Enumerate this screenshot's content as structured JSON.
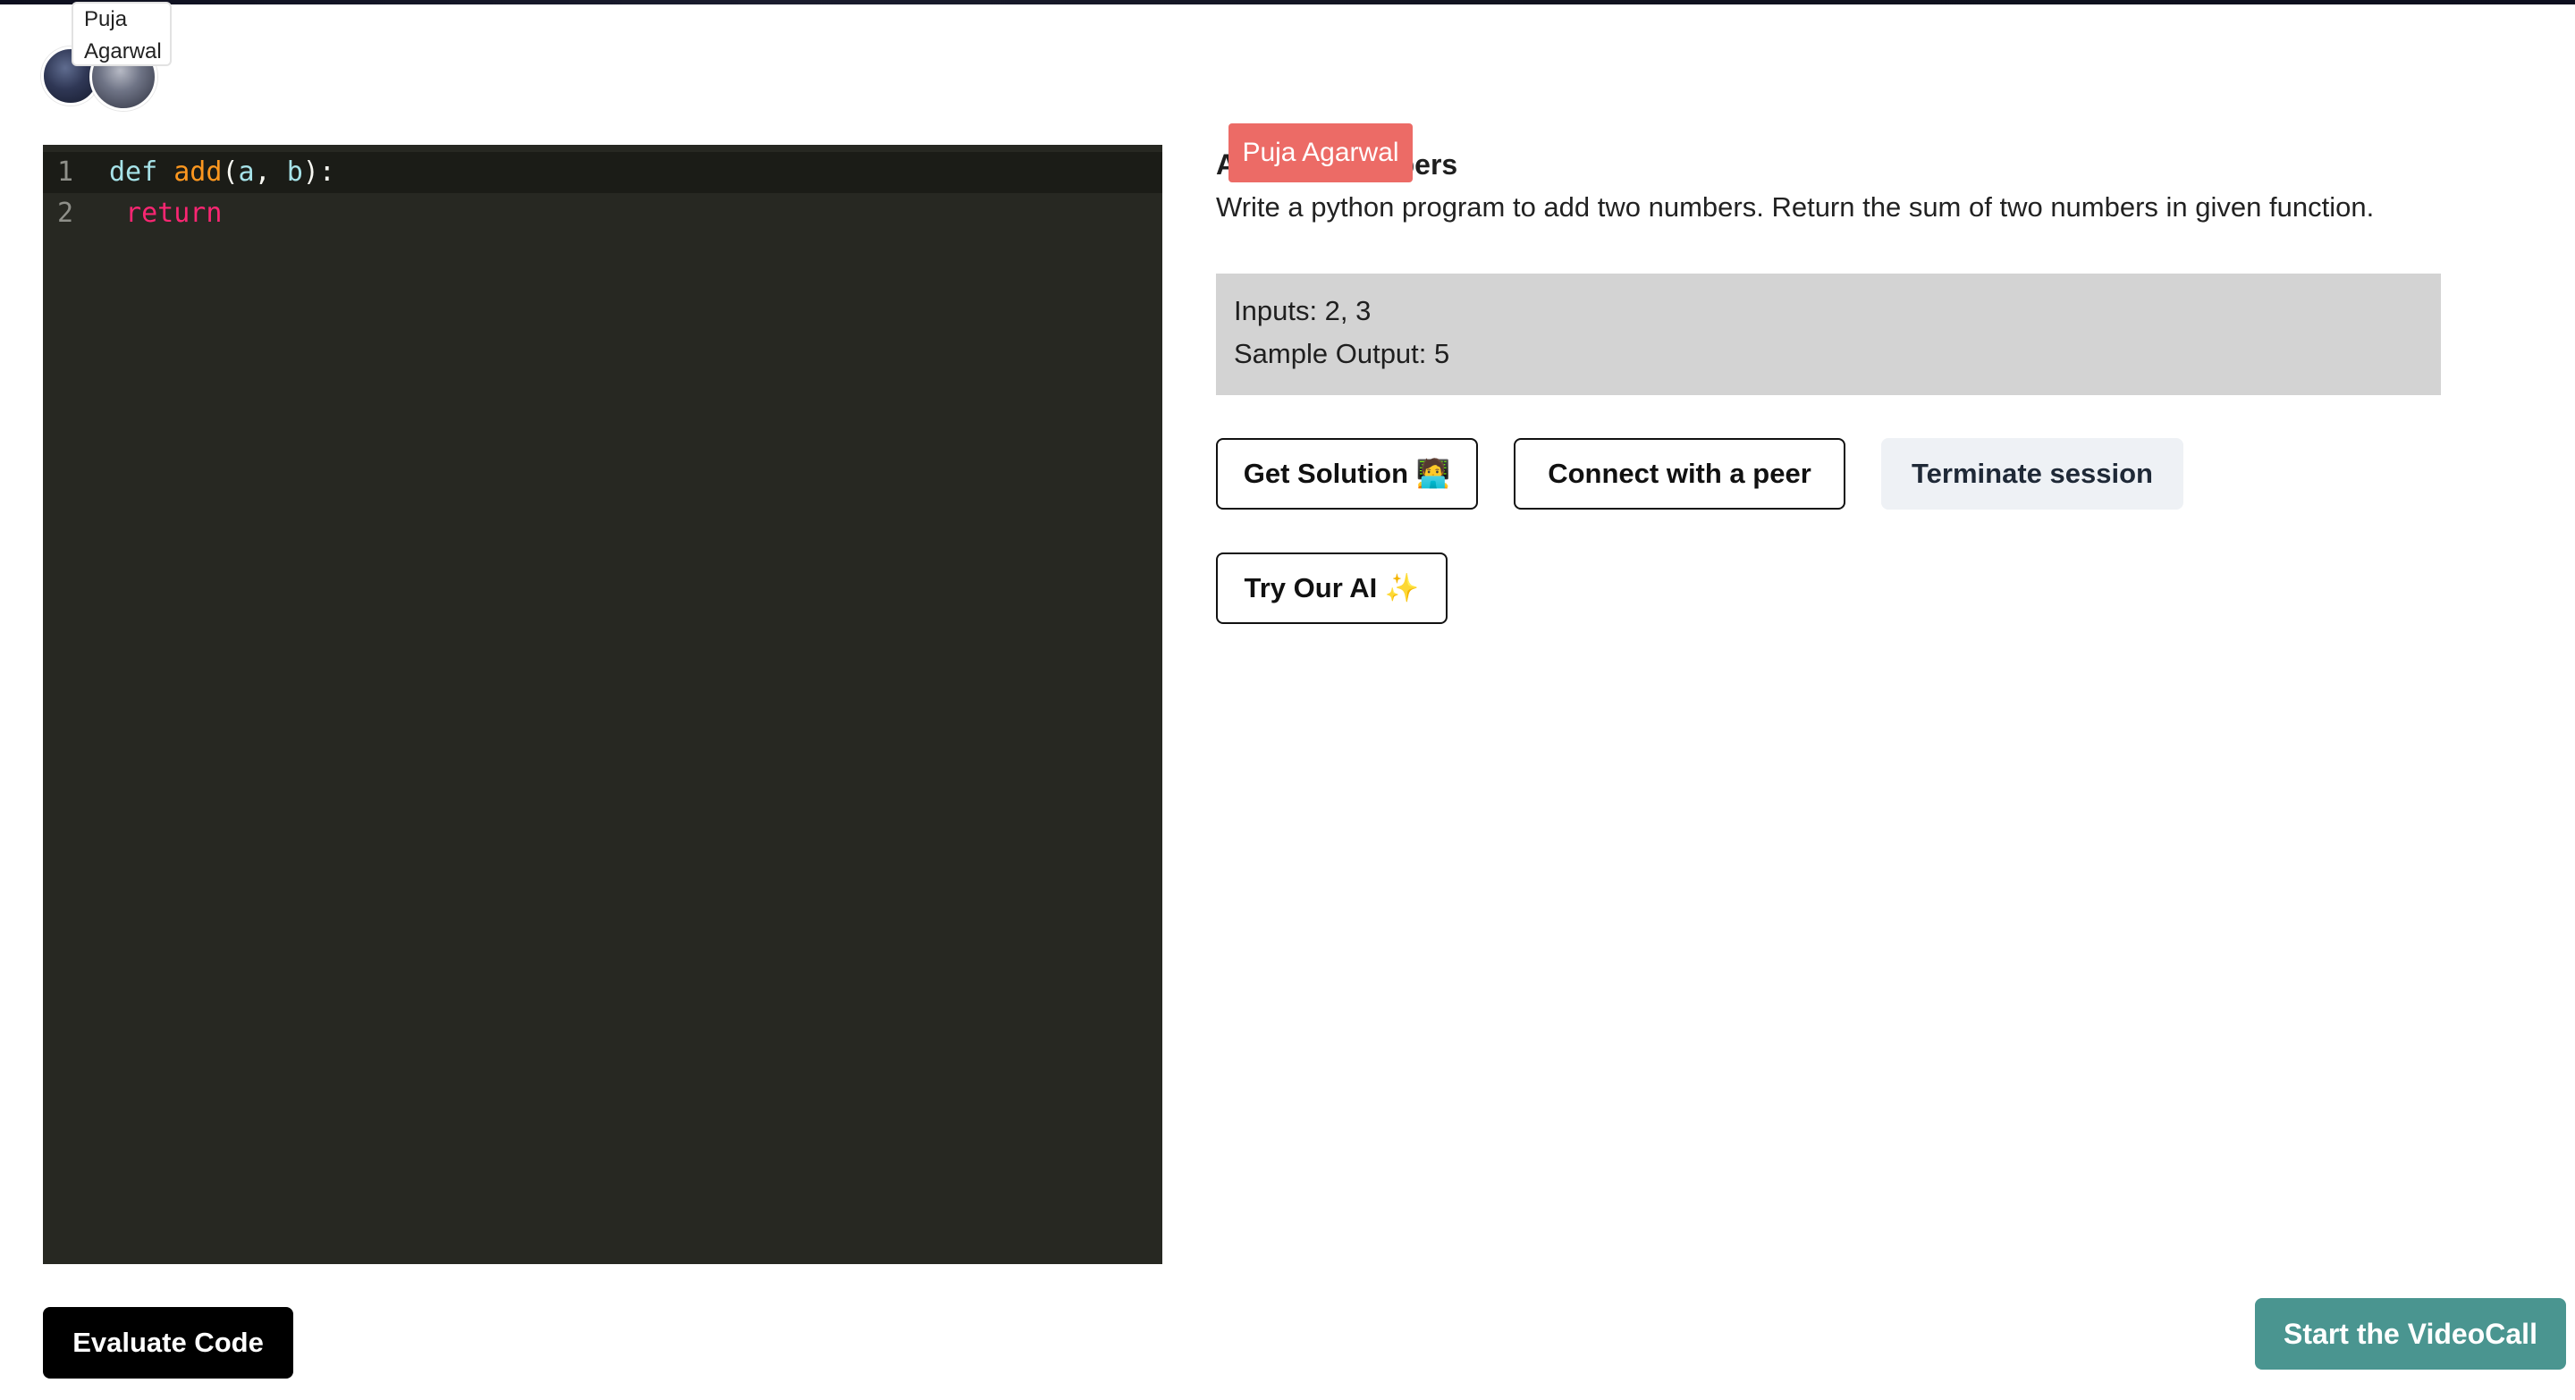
{
  "session": {
    "tooltip_name": "Puja\nAgarwal",
    "peer_label": "Puja Agarwal"
  },
  "editor": {
    "lines": [
      {
        "number": "1",
        "parts": [
          "def",
          " ",
          "add",
          "(",
          "a",
          ", ",
          "b",
          "):"
        ]
      },
      {
        "number": "2",
        "parts": [
          " ",
          "return"
        ]
      }
    ]
  },
  "question": {
    "title": "Add two numbers",
    "description": "Write a python program to add two numbers. Return the sum of two numbers in given function.",
    "sample_inputs": "Inputs: 2, 3",
    "sample_output": "Sample Output: 5"
  },
  "actions": {
    "get_solution": "Get Solution",
    "get_solution_emoji": "🧑‍💻",
    "connect_peer": "Connect with a peer",
    "terminate": "Terminate session",
    "try_ai": "Try Our AI",
    "try_ai_emoji": "✨",
    "evaluate": "Evaluate Code",
    "start_video": "Start the VideoCall"
  },
  "colors": {
    "editor_bg": "#272822",
    "peer_label_bg": "#ec6b66",
    "video_button_bg": "#4a9590"
  }
}
